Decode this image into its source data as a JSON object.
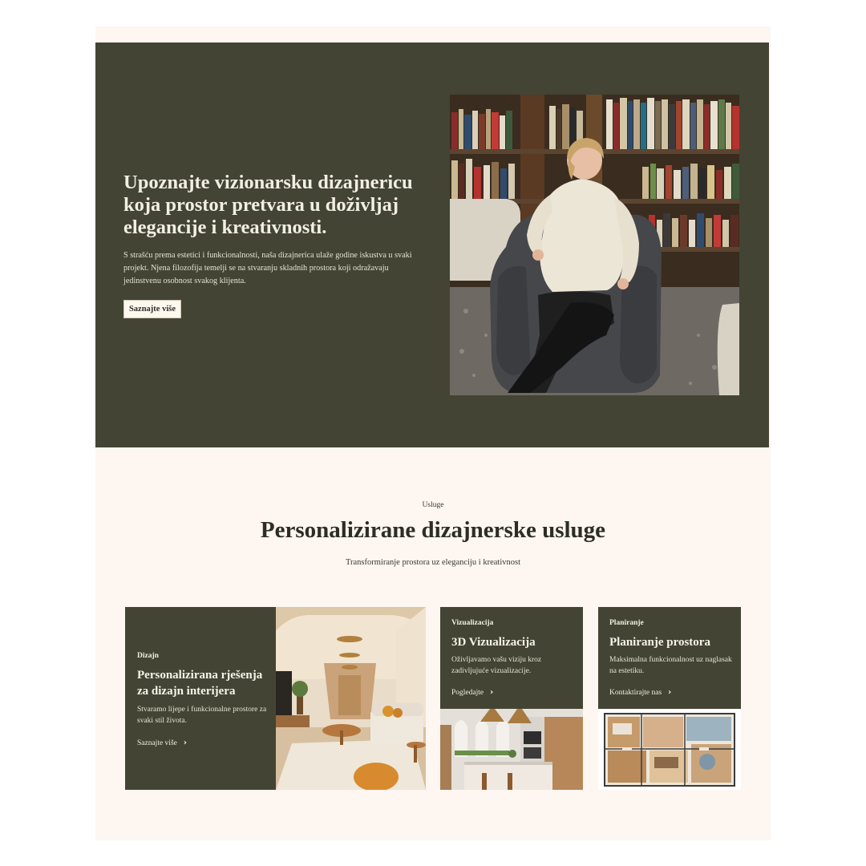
{
  "hero": {
    "title": "Upoznajte vizionarsku dizajnericu koja prostor pretvara u doživljaj elegancije i kreativnosti.",
    "text": "S strašću prema estetici i funkcionalnosti, naša dizajnerica ulaže godine iskustva u svaki projekt. Njena filozofija temelji se na stvaranju skladnih prostora koji odražavaju jedinstvenu osobnost svakog klijenta.",
    "button_label": "Saznajte više"
  },
  "services": {
    "eyebrow": "Usluge",
    "title": "Personalizirane dizajnerske usluge",
    "subtitle": "Transformiranje prostora uz eleganciju i kreativnost",
    "cards": [
      {
        "tag": "Dizajn",
        "title": "Personalizirana rješenja za dizajn interijera",
        "text": "Stvaramo lijepe i funkcionalne prostore za svaki stil života.",
        "link": "Saznajte više"
      },
      {
        "tag": "Vizualizacija",
        "title": "3D Vizualizacija",
        "text": "Oživljavamo vašu viziju kroz zadivljujuće vizualizacije.",
        "link": "Pogledajte"
      },
      {
        "tag": "Planiranje",
        "title": "Planiranje prostora",
        "text": "Maksimalna funkcionalnost uz naglasak na estetiku.",
        "link": "Kontaktirajte nas"
      }
    ]
  },
  "colors": {
    "olive": "#434433",
    "cream": "#fdf6f1",
    "button_bg": "#fdf7ef"
  },
  "icons": [
    "chevron-right-icon"
  ]
}
